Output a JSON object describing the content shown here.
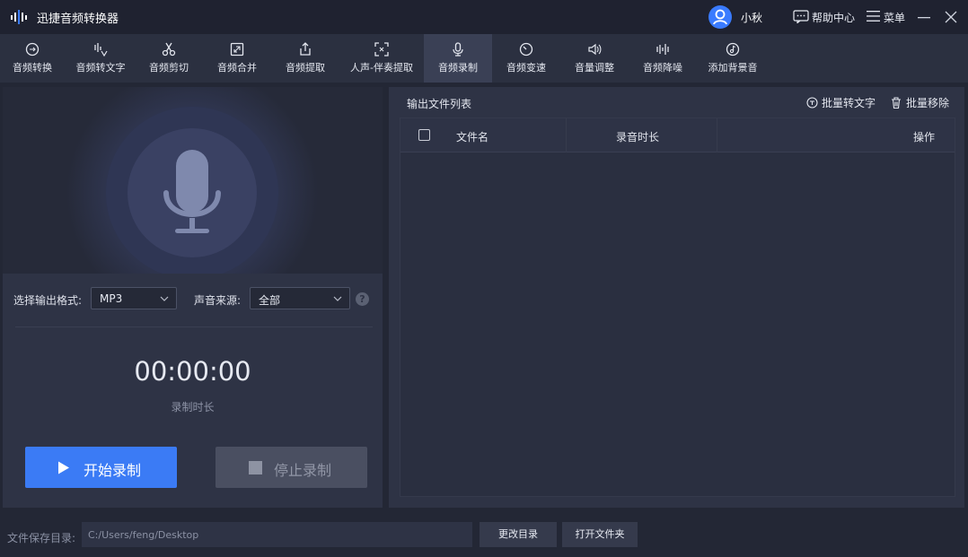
{
  "app": {
    "title": "迅捷音频转换器"
  },
  "header": {
    "username": "小秋",
    "help_label": "帮助中心",
    "menu_label": "菜单"
  },
  "tools": [
    {
      "label": "音频转换",
      "icon": "audio-convert-icon"
    },
    {
      "label": "音频转文字",
      "icon": "audio-to-text-icon"
    },
    {
      "label": "音频剪切",
      "icon": "scissors-icon"
    },
    {
      "label": "音频合并",
      "icon": "merge-icon"
    },
    {
      "label": "音频提取",
      "icon": "export-icon"
    },
    {
      "label": "人声-伴奏提取",
      "icon": "vocal-extract-icon"
    },
    {
      "label": "音频录制",
      "icon": "microphone-icon",
      "active": true
    },
    {
      "label": "音频变速",
      "icon": "speed-icon"
    },
    {
      "label": "音量调整",
      "icon": "volume-icon"
    },
    {
      "label": "音频降噪",
      "icon": "denoise-icon"
    },
    {
      "label": "添加背景音",
      "icon": "music-note-icon"
    }
  ],
  "recorder": {
    "format_label": "选择输出格式:",
    "format_value": "MP3",
    "source_label": "声音来源:",
    "source_value": "全部",
    "timer": "00:00:00",
    "timer_label": "录制时长",
    "start_label": "开始录制",
    "stop_label": "停止录制"
  },
  "output_list": {
    "title": "输出文件列表",
    "batch_convert_label": "批量转文字",
    "batch_remove_label": "批量移除",
    "columns": [
      "文件名",
      "录音时长",
      "操作"
    ]
  },
  "footer": {
    "save_dir_label": "文件保存目录:",
    "save_dir_value": "C:/Users/feng/Desktop",
    "change_dir_label": "更改目录",
    "open_folder_label": "打开文件夹"
  },
  "colors": {
    "accent": "#3b7bf5",
    "background": "#232735",
    "panel": "#2e3345"
  }
}
